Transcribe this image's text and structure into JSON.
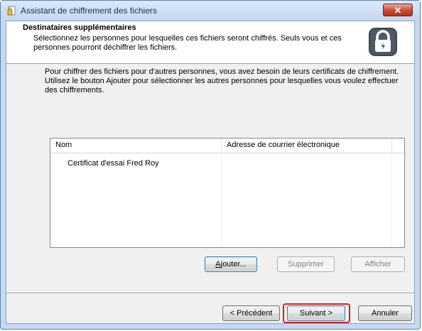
{
  "window": {
    "title": "Assistant de chiffrement des fichiers",
    "close_label": "✕"
  },
  "header": {
    "title": "Destinataires supplémentaires",
    "description": "Sélectionnez les personnes pour lesquelles ces fichiers seront chiffrés. Seuls vous et ces personnes pourront déchiffrer les fichiers."
  },
  "body": {
    "instructions": "Pour chiffrer des fichiers pour d'autres personnes, vous avez besoin de leurs certificats de chiffrement. Utilisez le bouton Ajouter pour sélectionner les autres personnes pour lesquelles vous voulez effectuer des chiffrements."
  },
  "list": {
    "columns": [
      "Nom",
      "Adresse de courrier électronique"
    ],
    "rows": [
      {
        "name": "Certificat d'essai Fred Roy",
        "email": ""
      }
    ]
  },
  "list_buttons": {
    "add_rest": "jouter...",
    "add_mnemonic": "A",
    "remove": "Supprimer",
    "show": "Afficher"
  },
  "nav_buttons": {
    "back": "< Précédent",
    "next": "Suivant >",
    "cancel": "Annuler"
  },
  "colors": {
    "highlight": "#e21b1b",
    "title_bar": "#c5daf0"
  },
  "icons": {
    "title": "encrypted-file-icon",
    "header": "lock-icon"
  }
}
